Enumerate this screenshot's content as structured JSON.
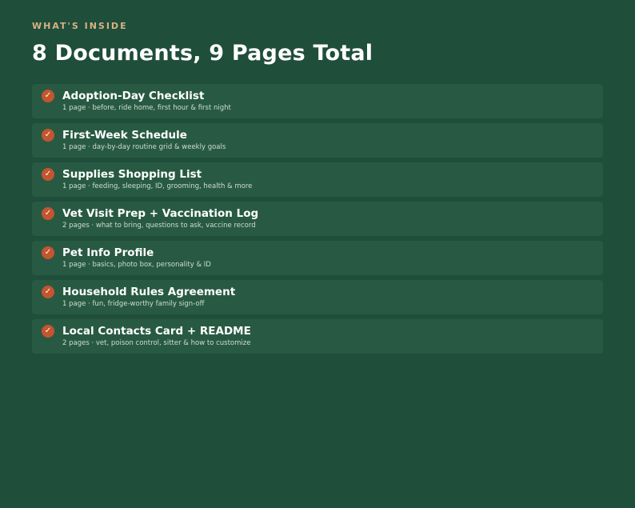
{
  "header": {
    "eyebrow": "WHAT'S INSIDE",
    "title": "8 Documents, 9 Pages Total"
  },
  "check_icon_glyph": "✓",
  "colors": {
    "background": "#1f4e3b",
    "card": "#285a43",
    "eyebrow": "#d9b382",
    "check_badge": "#c4552f"
  },
  "documents": [
    {
      "title": "Adoption-Day Checklist",
      "subtitle": "1 page · before, ride home, first hour & first night"
    },
    {
      "title": "First-Week Schedule",
      "subtitle": "1 page · day-by-day routine grid & weekly goals"
    },
    {
      "title": "Supplies Shopping List",
      "subtitle": "1 page · feeding, sleeping, ID, grooming, health & more"
    },
    {
      "title": "Vet Visit Prep + Vaccination Log",
      "subtitle": "2 pages · what to bring, questions to ask, vaccine record"
    },
    {
      "title": "Pet Info Profile",
      "subtitle": "1 page · basics, photo box, personality & ID"
    },
    {
      "title": "Household Rules Agreement",
      "subtitle": "1 page · fun, fridge-worthy family sign-off"
    },
    {
      "title": "Local Contacts Card + README",
      "subtitle": "2 pages · vet, poison control, sitter & how to customize"
    }
  ]
}
